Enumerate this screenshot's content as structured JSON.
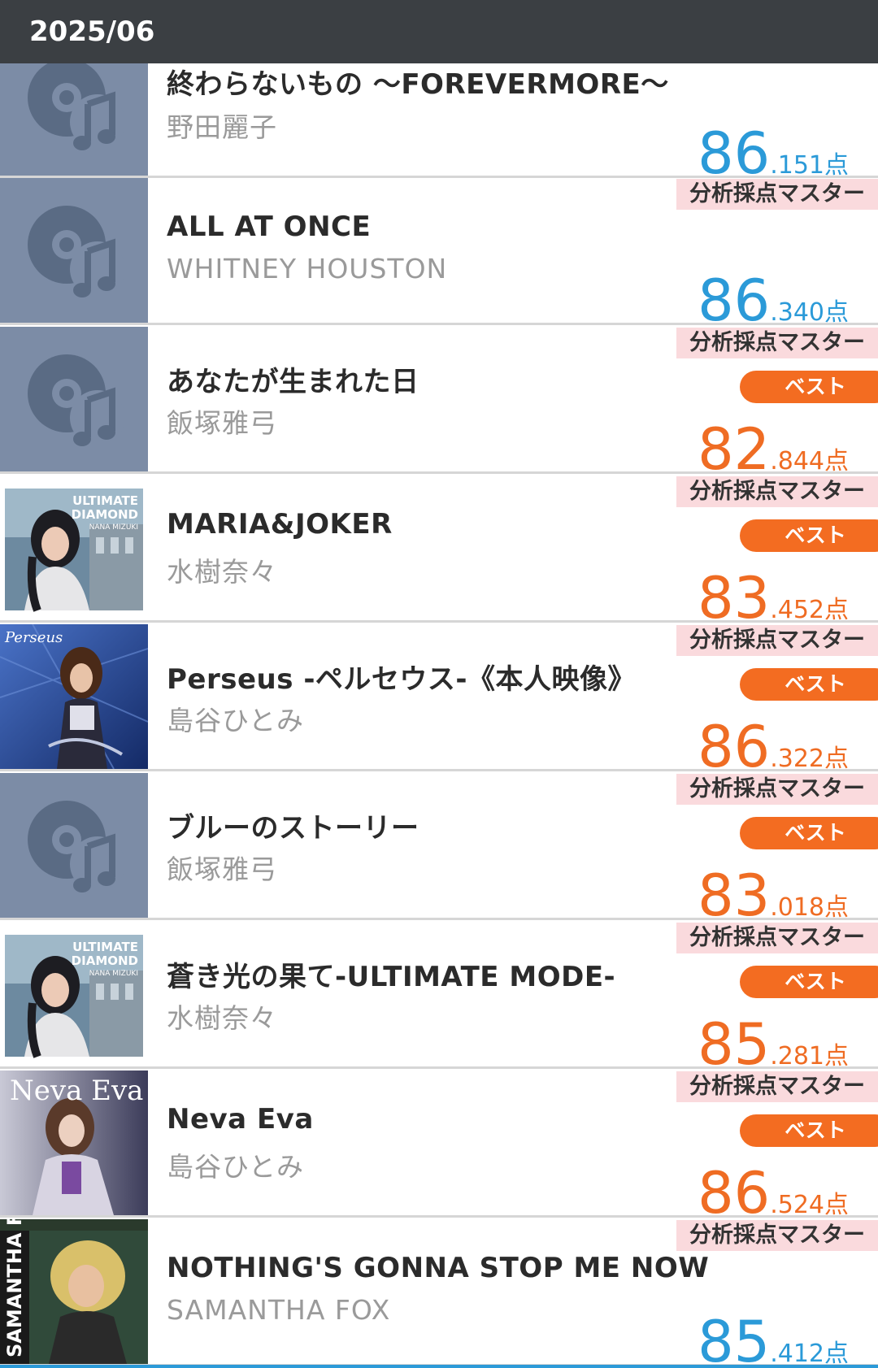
{
  "header": {
    "title": "2025/06"
  },
  "labels": {
    "master": "分析採点マスター",
    "best": "ベスト",
    "unit": "点"
  },
  "colors": {
    "header_bg": "#3b3f43",
    "score_blue": "#2b9ad8",
    "score_orange": "#ef6c23",
    "best_badge": "#f36c21",
    "master_badge_bg": "#fadadd",
    "placeholder_bg": "#7c8ca6"
  },
  "songs": [
    {
      "title": "終わらないもの 〜FOREVERMORE〜",
      "artist": "野田麗子",
      "score_int": "86",
      "score_dec": ".151",
      "best": false,
      "thumb": "disc-music-icon"
    },
    {
      "title": "ALL AT ONCE",
      "artist": "WHITNEY HOUSTON",
      "score_int": "86",
      "score_dec": ".340",
      "best": false,
      "thumb": "disc-music-icon"
    },
    {
      "title": "あなたが生まれた日",
      "artist": "飯塚雅弓",
      "score_int": "82",
      "score_dec": ".844",
      "best": true,
      "thumb": "disc-music-icon"
    },
    {
      "title": "MARIA&JOKER",
      "artist": "水樹奈々",
      "score_int": "83",
      "score_dec": ".452",
      "best": true,
      "thumb": "album-art-ultimate-diamond"
    },
    {
      "title": "Perseus -ペルセウス-《本人映像》",
      "artist": "島谷ひとみ",
      "score_int": "86",
      "score_dec": ".322",
      "best": true,
      "thumb": "album-art-perseus"
    },
    {
      "title": "ブルーのストーリー",
      "artist": "飯塚雅弓",
      "score_int": "83",
      "score_dec": ".018",
      "best": true,
      "thumb": "disc-music-icon"
    },
    {
      "title": "蒼き光の果て-ULTIMATE MODE-",
      "artist": "水樹奈々",
      "score_int": "85",
      "score_dec": ".281",
      "best": true,
      "thumb": "album-art-ultimate-diamond"
    },
    {
      "title": "Neva Eva",
      "artist": "島谷ひとみ",
      "score_int": "86",
      "score_dec": ".524",
      "best": true,
      "thumb": "album-art-neva-eva"
    },
    {
      "title": "NOTHING'S GONNA STOP ME NOW",
      "artist": "SAMANTHA FOX",
      "score_int": "85",
      "score_dec": ".412",
      "best": false,
      "thumb": "album-art-samantha-fox"
    }
  ],
  "album_text": {
    "ultimate_diamond": [
      "ULTIMATE",
      "DIAMOND",
      "NANA MIZUKI"
    ],
    "perseus": "Perseus",
    "neva_eva": "Neva Eva",
    "samantha_fox": "SAMANTHA FOX"
  }
}
